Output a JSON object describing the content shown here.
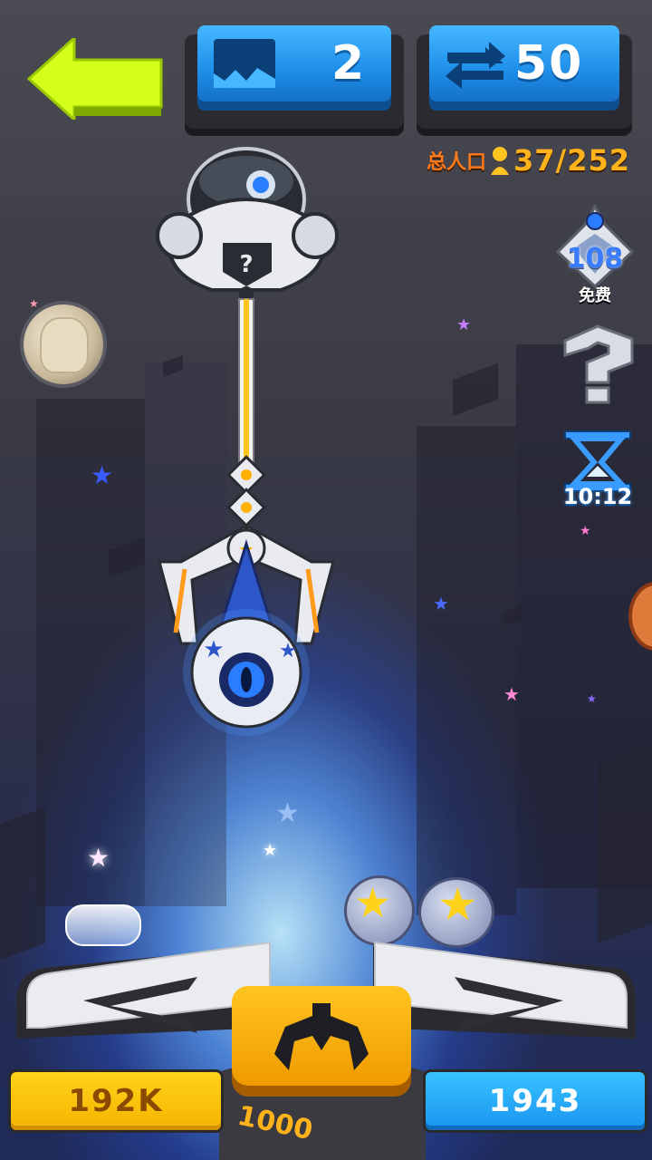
{
  "hud": {
    "map_count": "2",
    "refresh_count": "50",
    "population_label": "总人口",
    "population_value": "37/252"
  },
  "side": {
    "spin_count": "108",
    "spin_label": "免费",
    "timer": "10:12"
  },
  "bottom": {
    "gold": "192K",
    "gems": "1943",
    "grab_cost": "1000"
  },
  "colors": {
    "back_arrow": "#d4ff1a",
    "hud_blue": "#1e8ee8",
    "gold_bar": "#ffc41f",
    "gem_bar": "#1a95f0",
    "population_label": "#ff7a1a",
    "population_value": "#ffb21a"
  },
  "icons": {
    "back": "back-arrow-icon",
    "map": "monster-map-icon",
    "refresh": "refresh-arrows-icon",
    "population": "person-icon",
    "spin": "badge-icon",
    "mystery": "question-mark-icon",
    "timer": "hourglass-icon",
    "grab": "claw-icon"
  }
}
